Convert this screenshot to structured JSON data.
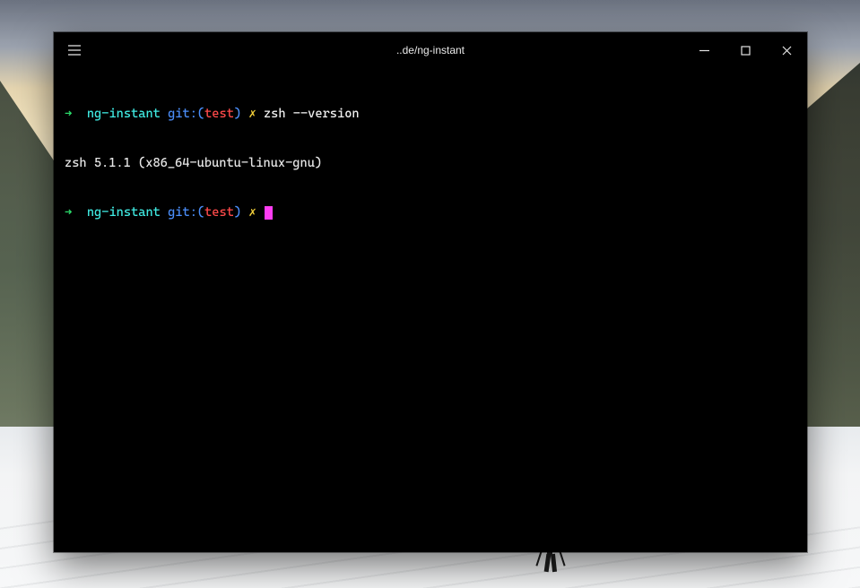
{
  "window": {
    "title": "..de/ng-instant"
  },
  "colors": {
    "arrow": "#2bdc6b",
    "dir": "#3fe9e1",
    "git_label": "#4a8df8",
    "branch": "#ff4a4a",
    "dirty": "#f4d13a",
    "cursor": "#ff3df2",
    "bg": "#000000"
  },
  "prompt": {
    "arrow": "➜",
    "dir": "ng-instant",
    "git_prefix": "git:(",
    "branch": "test",
    "git_suffix": ")",
    "dirty_mark": "✗"
  },
  "lines": {
    "l1_cmd": "zsh --version",
    "l2_output": "zsh 5.1.1 (x86_64-ubuntu-linux-gnu)"
  }
}
